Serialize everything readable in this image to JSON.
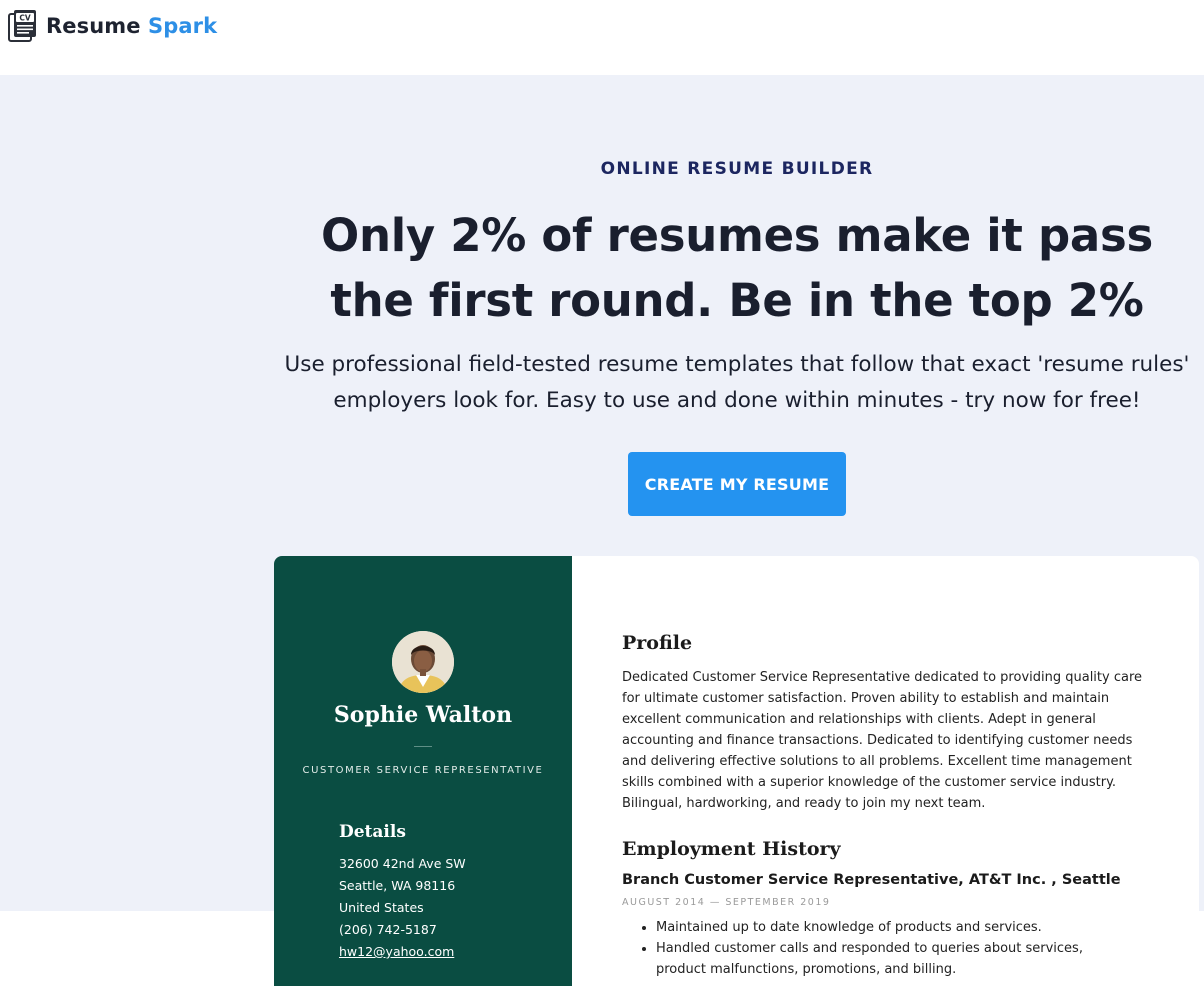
{
  "brand": {
    "word1": "Resume",
    "word2": "Spark",
    "icon": "cv-document-icon"
  },
  "hero": {
    "eyebrow": "ONLINE RESUME BUILDER",
    "headline": "Only 2% of resumes make it pass the first round. Be in the top 2%",
    "subtext": "Use professional field-tested resume templates that follow that exact 'resume rules' employers look for. Easy to use and done within minutes - try now for free!",
    "cta_label": "CREATE MY RESUME"
  },
  "resume": {
    "name": "Sophie Walton",
    "role": "CUSTOMER SERVICE REPRESENTATIVE",
    "details_heading": "Details",
    "details": [
      "32600 42nd Ave SW",
      "Seattle, WA 98116",
      "United States",
      "(206) 742-5187"
    ],
    "email": "hw12@yahoo.com",
    "profile_heading": "Profile",
    "profile_text": "Dedicated Customer Service Representative dedicated to providing quality care for ultimate customer satisfaction. Proven ability to establish and maintain excellent communication and relationships with clients. Adept in general accounting and finance transactions. Dedicated to identifying customer needs and delivering effective solutions to all problems. Excellent time management skills combined with a superior knowledge of the customer service industry. Bilingual, hardworking, and ready to join my next team.",
    "employment_heading": "Employment History",
    "job_title": "Branch Customer Service Representative, AT&T Inc. , Seattle",
    "job_dates": "AUGUST 2014 — SEPTEMBER 2019",
    "bullets": [
      "Maintained up to date knowledge of products and services.",
      "Handled customer calls and responded to queries about services, product malfunctions, promotions, and billing."
    ]
  },
  "colors": {
    "brand_blue": "#2d8fe6",
    "cta_blue": "#2493f0",
    "hero_bg": "#eef1f9",
    "resume_sidebar": "#0a4d42",
    "heading_dark": "#1a1f2e"
  }
}
